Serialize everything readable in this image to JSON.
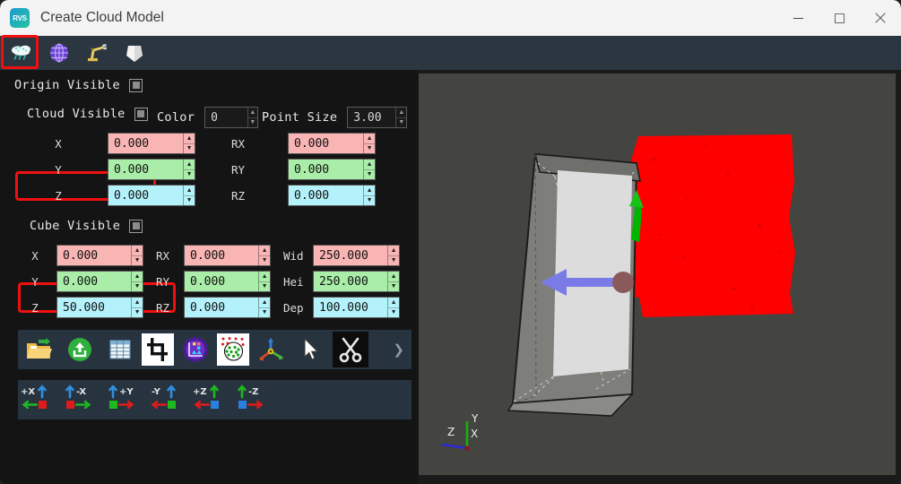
{
  "window": {
    "title": "Create Cloud Model",
    "logo_text": "RVS",
    "controls": [
      {
        "name": "minimize",
        "glyph": "minimize-icon"
      },
      {
        "name": "maximize",
        "glyph": "maximize-icon"
      },
      {
        "name": "close",
        "glyph": "close-icon"
      }
    ]
  },
  "tabs": [
    {
      "name": "point-cloud",
      "icon": "cloud-rain-icon",
      "selected": true
    },
    {
      "name": "grid",
      "icon": "grid-globe-icon",
      "selected": false
    },
    {
      "name": "robot",
      "icon": "robot-arm-icon",
      "selected": false
    },
    {
      "name": "mesh",
      "icon": "mesh-shape-icon",
      "selected": false
    }
  ],
  "panel": {
    "origin": {
      "label": "Origin Visible",
      "checked": true
    },
    "cloud": {
      "label": "Cloud Visible",
      "checked": true,
      "highlighted": true,
      "color_label": "Color",
      "color_value": "0",
      "point_size_label": "Point Size",
      "point_size_value": "3.00",
      "fields": [
        {
          "label": "X",
          "value": "0.000",
          "color": "pink"
        },
        {
          "label": "Y",
          "value": "0.000",
          "color": "green"
        },
        {
          "label": "Z",
          "value": "0.000",
          "color": "cyan"
        },
        {
          "label": "RX",
          "value": "0.000",
          "color": "pink"
        },
        {
          "label": "RY",
          "value": "0.000",
          "color": "green"
        },
        {
          "label": "RZ",
          "value": "0.000",
          "color": "cyan"
        }
      ]
    },
    "cube": {
      "label": "Cube Visible",
      "checked": true,
      "highlighted": true,
      "fields": [
        {
          "label": "X",
          "value": "0.000",
          "color": "pink"
        },
        {
          "label": "Y",
          "value": "0.000",
          "color": "green"
        },
        {
          "label": "Z",
          "value": "50.000",
          "color": "cyan"
        },
        {
          "label": "RX",
          "value": "0.000",
          "color": "pink"
        },
        {
          "label": "RY",
          "value": "0.000",
          "color": "green"
        },
        {
          "label": "RZ",
          "value": "0.000",
          "color": "cyan"
        },
        {
          "label": "Wid",
          "value": "250.000",
          "color": "pink"
        },
        {
          "label": "Hei",
          "value": "250.000",
          "color": "green"
        },
        {
          "label": "Dep",
          "value": "100.000",
          "color": "cyan"
        }
      ]
    }
  },
  "toolbar": {
    "items": [
      {
        "name": "open-folder",
        "icon": "folder-open-icon"
      },
      {
        "name": "export",
        "icon": "upload-circle-icon"
      },
      {
        "name": "table",
        "icon": "table-grid-icon"
      },
      {
        "name": "crop",
        "icon": "crop-icon"
      },
      {
        "name": "chart",
        "icon": "chart-plot-icon"
      },
      {
        "name": "cluster",
        "icon": "point-cluster-icon"
      },
      {
        "name": "axes",
        "icon": "coordinate-axes-icon"
      },
      {
        "name": "select-cursor",
        "icon": "arrow-cursor-icon"
      },
      {
        "name": "cut",
        "icon": "scissors-icon"
      }
    ],
    "overflow": "chevron-right-icon"
  },
  "axisbar": {
    "buttons": [
      {
        "name": "view-plus-x",
        "label": "+X",
        "label_side": "left",
        "square": "#e02020",
        "arrow_dir": "left"
      },
      {
        "name": "view-minus-x",
        "label": "-X",
        "label_side": "right",
        "square": "#e02020",
        "arrow_dir": "right"
      },
      {
        "name": "view-plus-y",
        "label": "+Y",
        "label_side": "right",
        "square": "#1fb81f",
        "arrow_dir": "right"
      },
      {
        "name": "view-minus-y",
        "label": "-Y",
        "label_side": "left",
        "square": "#1fb81f",
        "arrow_dir": "left"
      },
      {
        "name": "view-plus-z",
        "label": "+Z",
        "label_side": "left",
        "square": "#2b7fe0",
        "arrow_dir": "left"
      },
      {
        "name": "view-minus-z",
        "label": "-Z",
        "label_side": "right",
        "square": "#2b7fe0",
        "arrow_dir": "right"
      }
    ]
  },
  "viewport": {
    "axis_gizmo": {
      "x_label": "X",
      "y_label": "Y",
      "z_label": "Z"
    },
    "objects": {
      "point_cloud_color": "#fe0000",
      "cube_color": "#d4d4d4",
      "normal_arrow_color": "#7b7be8",
      "up_arrow_color": "#00b400"
    }
  }
}
